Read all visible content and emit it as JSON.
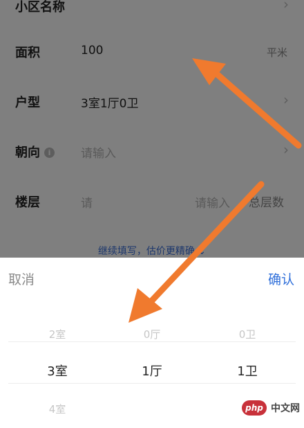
{
  "form": {
    "community": {
      "label": "小区名称",
      "chevron": "›"
    },
    "area": {
      "label": "面积",
      "value": "100",
      "unit": "平米"
    },
    "layout": {
      "label": "户型",
      "value": "3室1厅0卫",
      "chevron": "›"
    },
    "orientation": {
      "label": "朝向",
      "info_icon": "i",
      "placeholder": "请输入",
      "chevron": "›"
    },
    "floor": {
      "label": "楼层",
      "placeholder_left": "请",
      "placeholder_mid": "请输入",
      "placeholder_right": "总层数"
    },
    "expand_link": "继续填写，估价更精确 ⌄"
  },
  "picker": {
    "cancel_label": "取消",
    "confirm_label": "确认",
    "rooms": {
      "above": "2室",
      "selected": "3室",
      "below": "4室"
    },
    "halls": {
      "above": "0厅",
      "selected": "1厅"
    },
    "baths": {
      "above": "0卫",
      "selected": "1卫"
    }
  },
  "watermark": {
    "logo": "php",
    "text": "中文网"
  },
  "colors": {
    "accent": "#2f6fda",
    "arrow": "#f07a2e",
    "overlay": "rgba(0,0,0,0.5)"
  }
}
